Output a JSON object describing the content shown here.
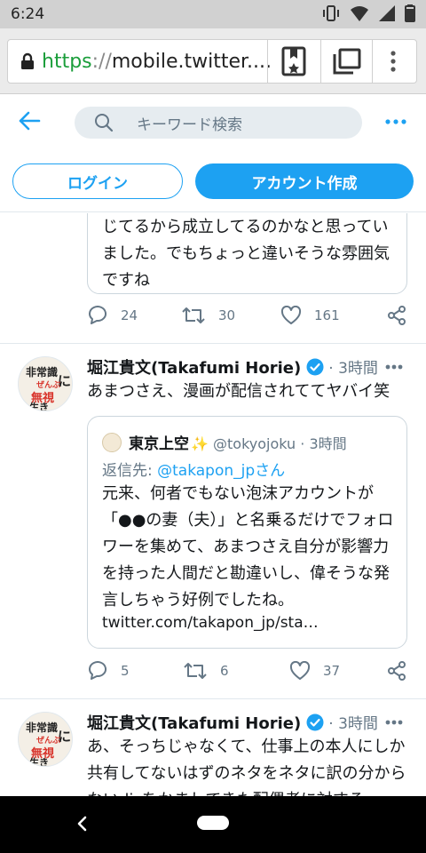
{
  "status_bar": {
    "time": "6:24"
  },
  "browser": {
    "url_scheme": "https",
    "url_sep": "://",
    "url_host": "mobile.twitter....",
    "colors": {
      "secure": "#1b9e3b"
    }
  },
  "nav": {
    "search_placeholder": "キーワード検索"
  },
  "auth": {
    "login_label": "ログイン",
    "signup_label": "アカウント作成"
  },
  "colors": {
    "twitter_blue": "#1da1f2",
    "muted": "#657786",
    "border": "#e1e8ed"
  },
  "timeline": {
    "partial_tweet": {
      "quote_text": "じてるから成立してるのかなと思っていました。でもちょっと違いそうな雰囲気ですね",
      "actions": {
        "replies": "24",
        "retweets": "30",
        "likes": "161"
      }
    },
    "tweets": [
      {
        "author_name": "堀江貴文(Takafumi Horie)",
        "meta": "· 3時間",
        "avatar_text": [
          "非常識",
          "に",
          "ぜんぶ",
          "無視",
          "生き"
        ],
        "text": "あまつさえ、漫画が配信されててヤバイ笑",
        "quote": {
          "name": "東京上空",
          "handle": "@tokyojoku · 3時間",
          "reply_prefix": "返信先: ",
          "reply_handle": "@takapon_jpさん",
          "text": "元来、何者でもない泡沫アカウントが「●●の妻（夫）」と名乗るだけでフォロワーを集めて、あまつさえ自分が影響力を持った人間だと勘違いし、偉そうな発言しちゃう好例でしたね。",
          "link": "twitter.com/takapon_jp/sta…"
        },
        "actions": {
          "replies": "5",
          "retweets": "6",
          "likes": "37"
        }
      },
      {
        "author_name": "堀江貴文(Takafumi Horie)",
        "meta": "· 3時間",
        "avatar_text": [
          "非常識",
          "に",
          "ぜんぶ",
          "無視",
          "生き"
        ],
        "text": "あ、そっちじゃなくて、仕事上の本人にしか共有してないはずのネタをネタに訳の分からないdisをかましてきた配偶者に対する"
      }
    ]
  }
}
